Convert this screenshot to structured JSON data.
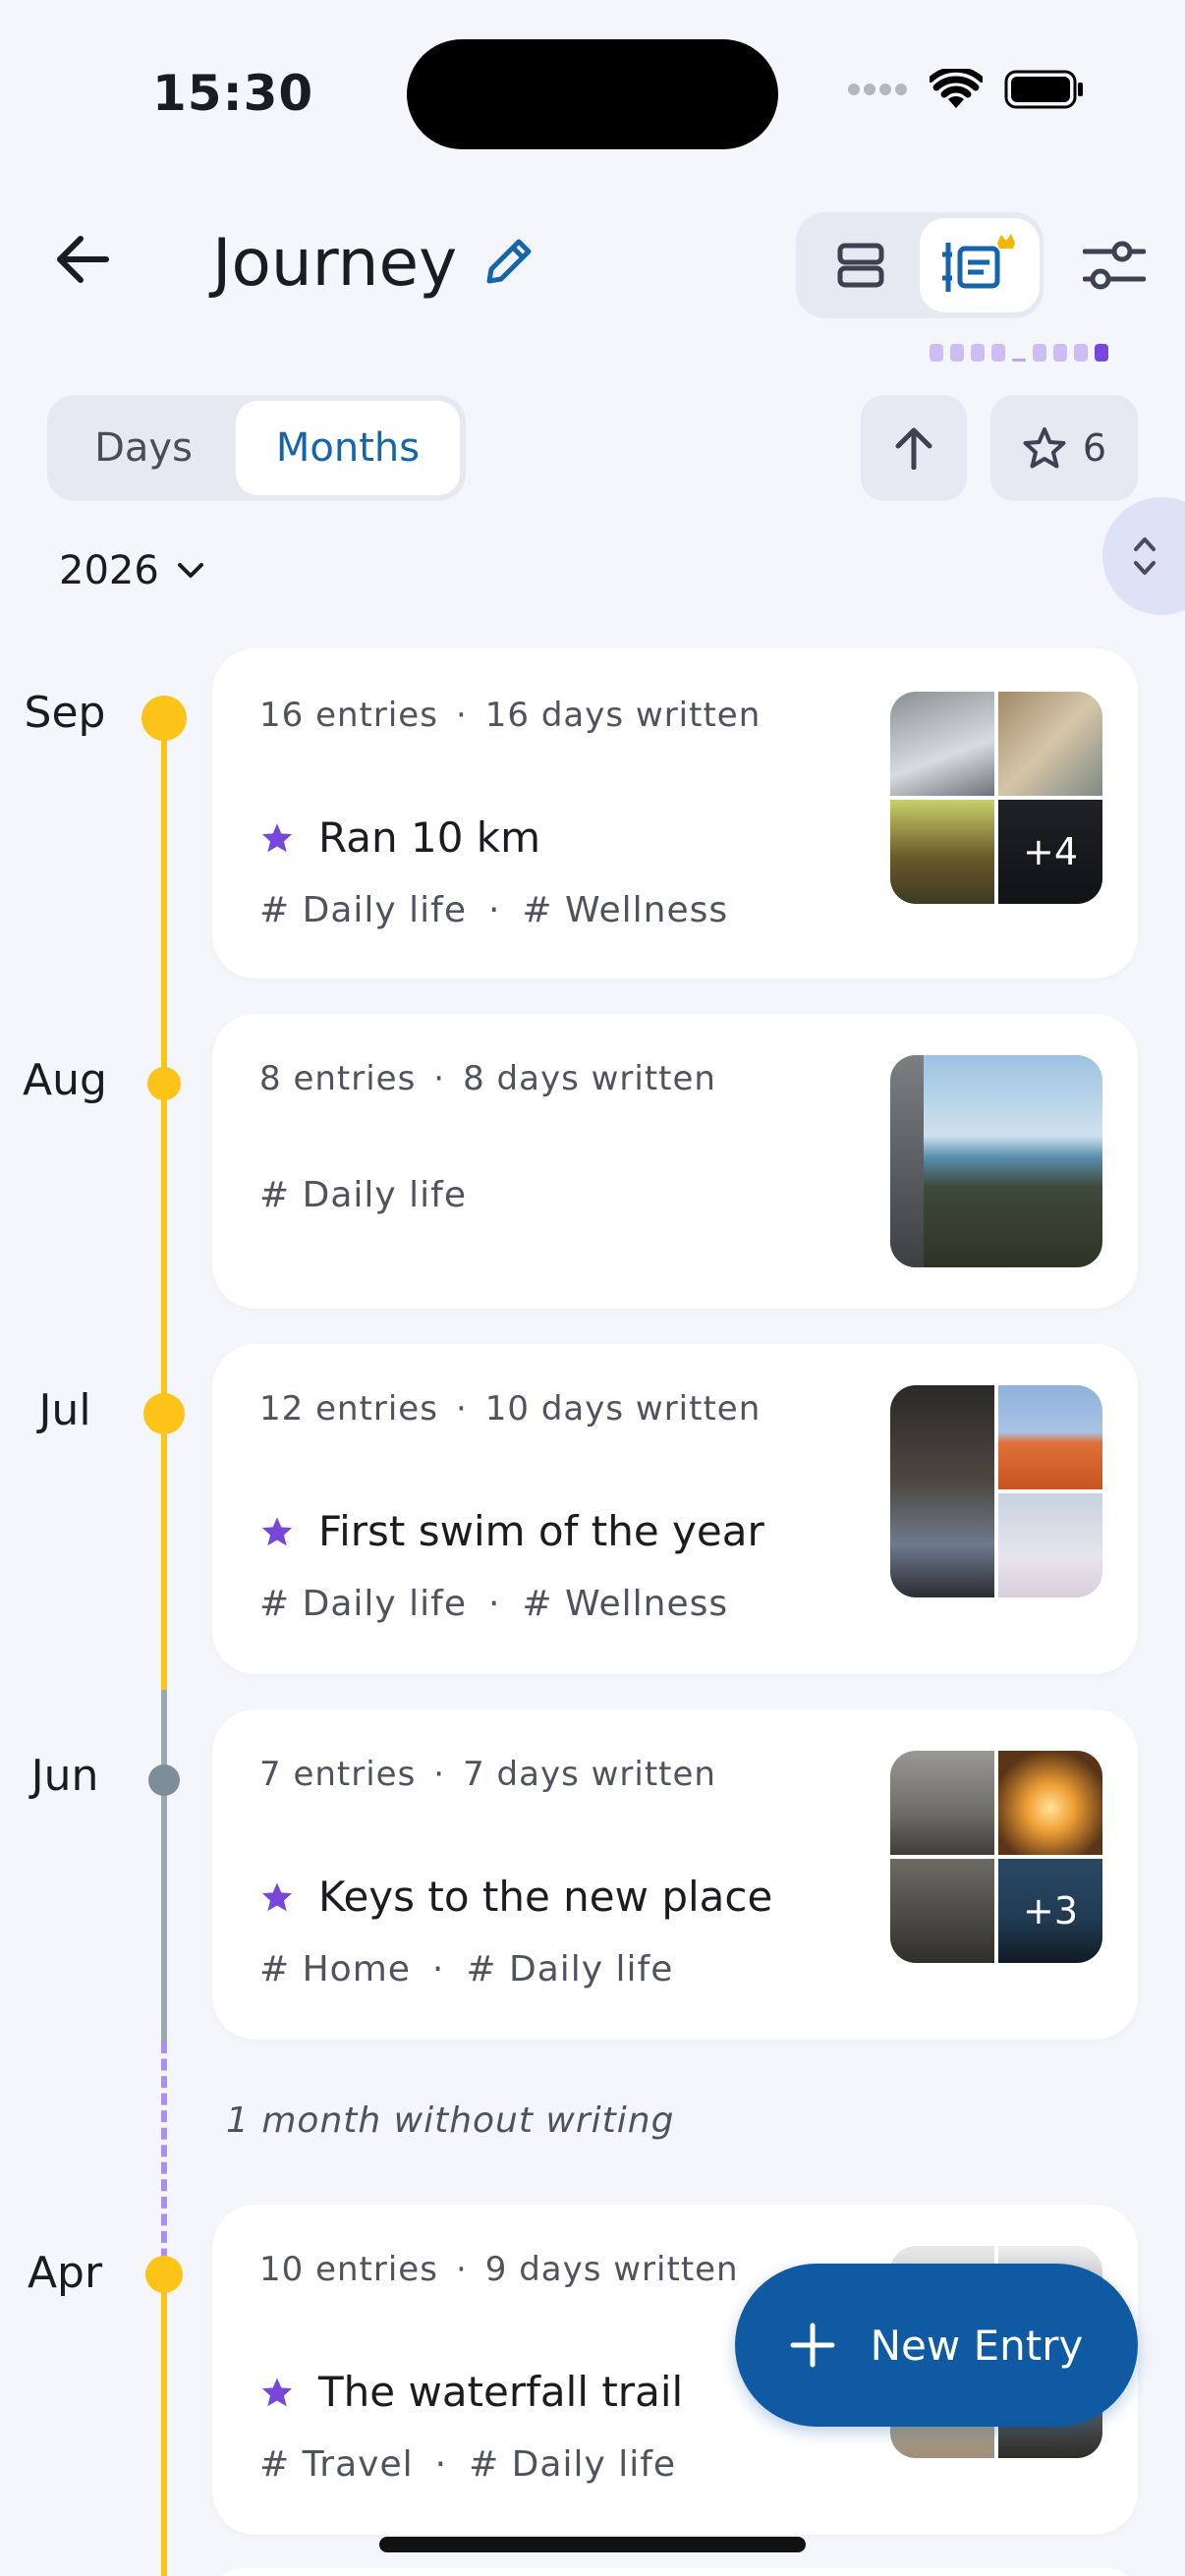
{
  "status_bar": {
    "time": "15:30"
  },
  "header": {
    "title": "Journey"
  },
  "segmented": {
    "days_label": "Days",
    "months_label": "Months",
    "selected": "Months"
  },
  "favorites": {
    "count": "6"
  },
  "year_picker": {
    "value": "2026"
  },
  "colors": {
    "accent": "#1565a8",
    "fab": "#0f5aa3",
    "timeline_yellow": "#fcc419",
    "timeline_gray": "#8a9aa6",
    "star_purple": "#7647d9"
  },
  "months": [
    {
      "label": "Sep",
      "entries": "16 entries",
      "days": "16 days written",
      "highlight": "Ran 10 km",
      "tags": [
        "# Daily life",
        "# Wellness"
      ],
      "more": "+4"
    },
    {
      "label": "Aug",
      "entries": "8 entries",
      "days": "8 days written",
      "highlight": "",
      "tags": [
        "# Daily life"
      ],
      "more": ""
    },
    {
      "label": "Jul",
      "entries": "12 entries",
      "days": "10 days written",
      "highlight": "First swim of the year",
      "tags": [
        "# Daily life",
        "# Wellness"
      ],
      "more": ""
    },
    {
      "label": "Jun",
      "entries": "7 entries",
      "days": "7 days written",
      "highlight": "Keys to the new place",
      "tags": [
        "# Home",
        "# Daily life"
      ],
      "more": "+3"
    },
    {
      "label": "Apr",
      "entries": "10 entries",
      "days": "9 days written",
      "highlight": "The waterfall trail",
      "tags": [
        "# Travel",
        "# Daily life"
      ],
      "more": ""
    }
  ],
  "gap_note": "1 month without writing",
  "fab": {
    "label": "New Entry"
  }
}
